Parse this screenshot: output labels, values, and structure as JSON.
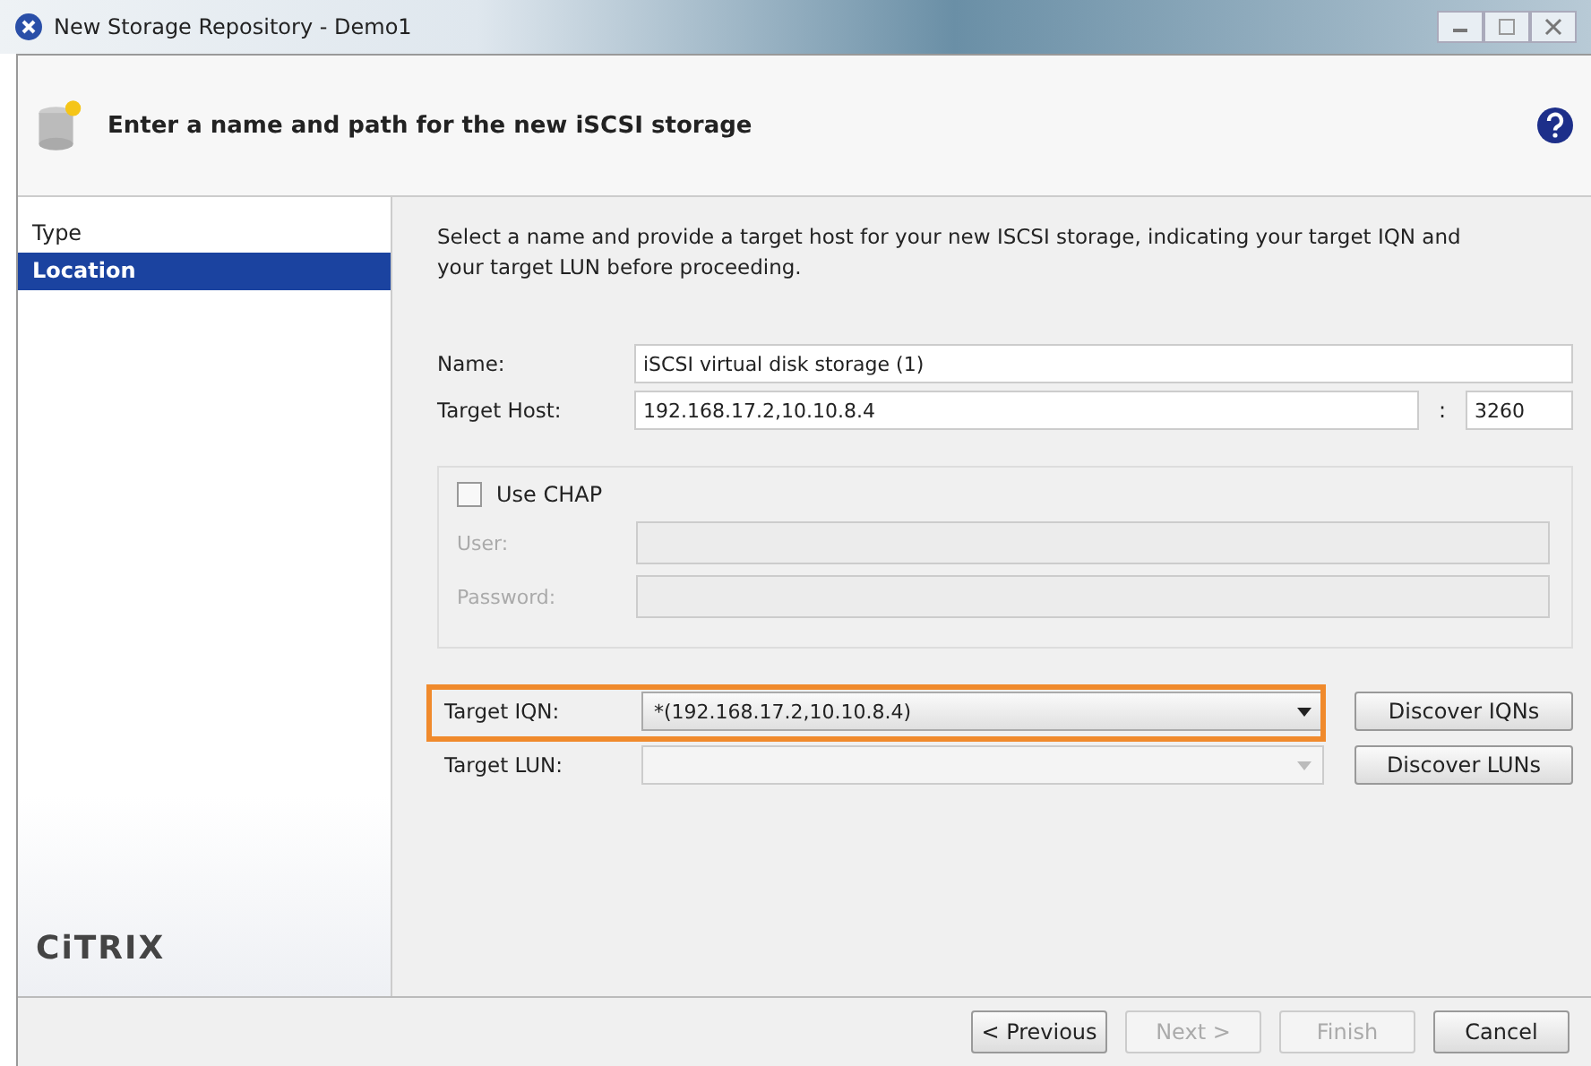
{
  "window": {
    "title": "New Storage Repository - Demo1"
  },
  "header": {
    "title": "Enter a name and path for the new iSCSI storage"
  },
  "sidebar": {
    "items": [
      {
        "label": "Type",
        "selected": false
      },
      {
        "label": "Location",
        "selected": true
      }
    ],
    "logo": "CiTRIX"
  },
  "intro": "Select a name and provide a target host for your new ISCSI storage, indicating your target IQN and your target LUN before proceeding.",
  "name": {
    "label": "Name:",
    "value": "iSCSI virtual disk storage (1)"
  },
  "target_host": {
    "label": "Target Host:",
    "value": "192.168.17.2,10.10.8.4",
    "separator": ":",
    "port": "3260"
  },
  "chap": {
    "label": "Use CHAP",
    "checked": false,
    "fields": [
      {
        "label": "User:",
        "disabled": true
      },
      {
        "label": "Password:",
        "disabled": true
      }
    ]
  },
  "targets": [
    {
      "label": "Target IQN:",
      "value": "*(192.168.17.2,10.10.8.4)",
      "highlighted": true,
      "disabled": false,
      "button": "Discover IQNs"
    },
    {
      "label": "Target LUN:",
      "highlighted": false,
      "disabled": true,
      "button": "Discover LUNs"
    }
  ],
  "buttons": [
    {
      "label": "< Previous",
      "disabled": false
    },
    {
      "label": "Next >",
      "disabled": true
    },
    {
      "label": "Finish",
      "disabled": true
    },
    {
      "label": "Cancel",
      "disabled": false
    }
  ]
}
